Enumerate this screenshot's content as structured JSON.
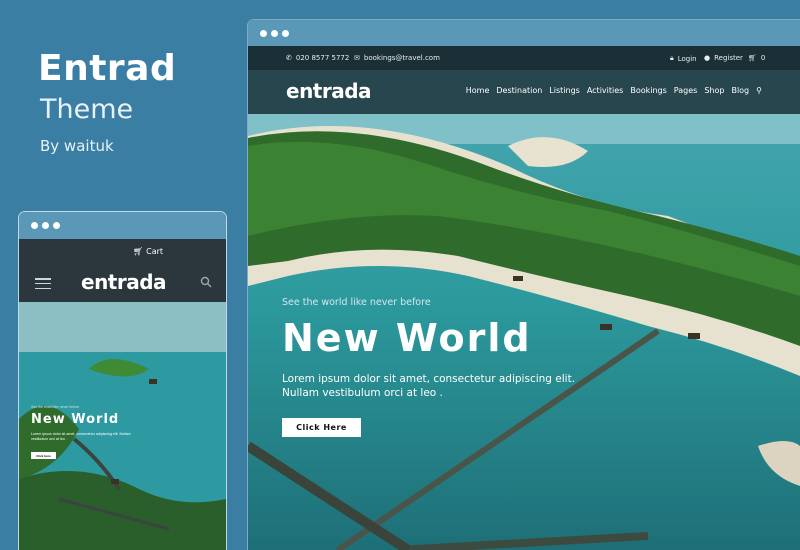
{
  "promo": {
    "title": "Entrad",
    "subtitle": "Theme",
    "byline": "By waituk"
  },
  "desktop": {
    "topbar": {
      "phone": "020 8577 5772",
      "email": "bookings@travel.com",
      "login": "Login",
      "register": "Register",
      "cart_count": "0"
    },
    "logo": "entrada",
    "nav": [
      "Home",
      "Destination",
      "Listings",
      "Activities",
      "Bookings",
      "Pages",
      "Shop",
      "Blog"
    ],
    "hero": {
      "kicker": "See the world like never before",
      "title": "New World",
      "text": "Lorem ipsum dolor sit amet, consectetur adipiscing elit. Nullam vestibulum orci at leo .",
      "button": "Click Here"
    }
  },
  "mobile": {
    "cart_label": "Cart",
    "logo": "entrada",
    "hero": {
      "kicker": "See the world like never before",
      "title": "New World",
      "text": "Lorem ipsum dolor sit amet, consectetur adipiscing elit. Nullam vestibulum orci at leo .",
      "button": "Click Here"
    }
  },
  "colors": {
    "background": "#3a7ea3",
    "titlebar": "#5b97b7",
    "sea": "#2a9aa3",
    "sand": "#e9e4d6",
    "forest": "#2f6b2a"
  },
  "icons": [
    "phone-icon",
    "mail-icon",
    "lock-icon",
    "user-icon",
    "cart-icon",
    "search-icon",
    "hamburger-menu-icon"
  ]
}
